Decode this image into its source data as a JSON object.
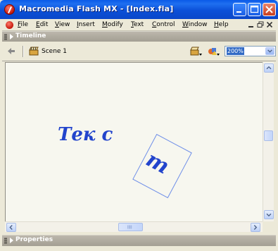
{
  "window": {
    "title": "Macromedia Flash MX - [Index.fla]"
  },
  "menu": {
    "items": [
      "File",
      "Edit",
      "View",
      "Insert",
      "Modify",
      "Text",
      "Control",
      "Window",
      "Help"
    ]
  },
  "panels": {
    "timeline_label": "Timeline",
    "properties_label": "Properties"
  },
  "scene": {
    "label": "Scene 1"
  },
  "zoom": {
    "value": "200%"
  },
  "stage": {
    "word_text": "Тек с",
    "rotated_letter": "т",
    "text_color": "#2244cc"
  },
  "colors": {
    "titlebar": "#0a5ae8",
    "selection": "#316ac5"
  },
  "icons": [
    "flash-app-icon",
    "minimize-icon",
    "maximize-icon",
    "close-icon",
    "back-arrow-icon",
    "scene-icon",
    "edit-symbol-icon",
    "edit-scene-icon"
  ]
}
